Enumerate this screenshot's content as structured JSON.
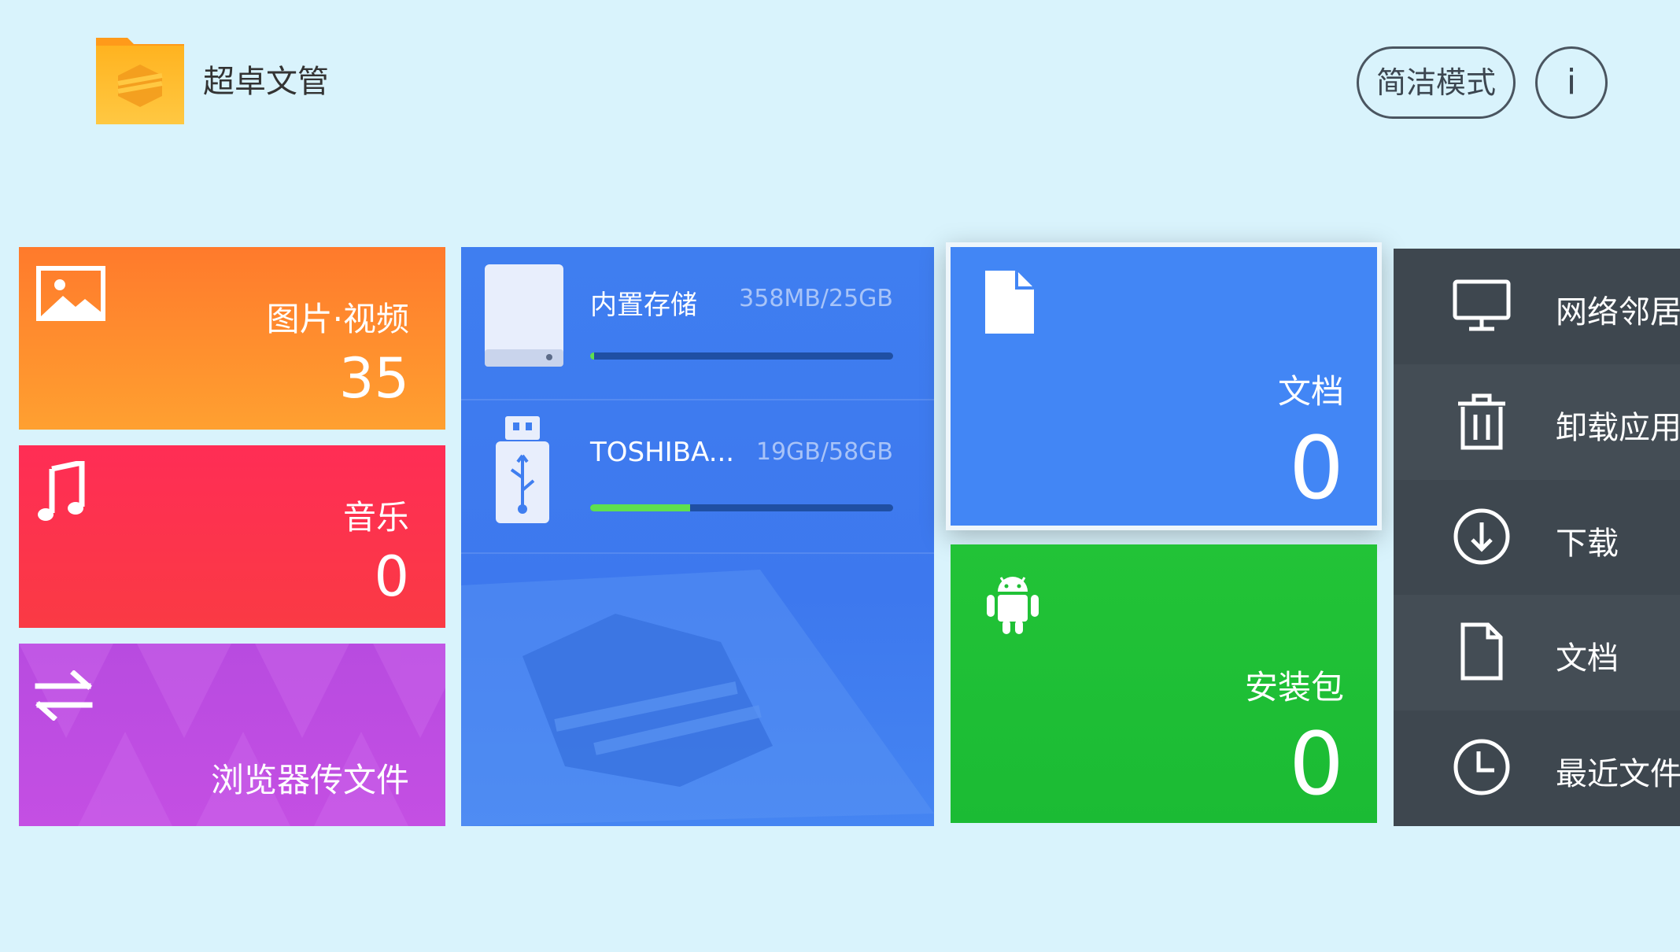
{
  "header": {
    "app_title": "超卓文管",
    "mode_button": "简洁模式",
    "info_button": "i"
  },
  "tiles": {
    "photos": {
      "label": "图片·视频",
      "count": "35"
    },
    "music": {
      "label": "音乐",
      "count": "0"
    },
    "web_transfer": {
      "label": "浏览器传文件"
    },
    "documents": {
      "label": "文档",
      "count": "0"
    },
    "apk": {
      "label": "安装包",
      "count": "0"
    }
  },
  "storage": [
    {
      "name": "内置存储",
      "size": "358MB/25GB",
      "used_fraction": 0.014,
      "icon": "internal-storage-icon"
    },
    {
      "name": "TOSHIBA...",
      "size": "19GB/58GB",
      "used_fraction": 0.33,
      "icon": "usb-drive-icon"
    }
  ],
  "quick_access": [
    {
      "label": "网络邻居",
      "icon": "monitor-icon"
    },
    {
      "label": "卸载应用",
      "icon": "trash-icon"
    },
    {
      "label": "下载",
      "icon": "download-icon"
    },
    {
      "label": "文档",
      "icon": "document-icon"
    },
    {
      "label": "最近文件",
      "icon": "clock-icon"
    }
  ],
  "colors": {
    "background": "#d9f3fc",
    "photos": "#ff8a2c",
    "music": "#ff2d55",
    "web_transfer": "#c04ae2",
    "storage": "#3f7ef0",
    "documents": "#4286f5",
    "apk": "#1fbf35",
    "panel": "#3f4850",
    "progress_fill": "#5ee04f"
  }
}
